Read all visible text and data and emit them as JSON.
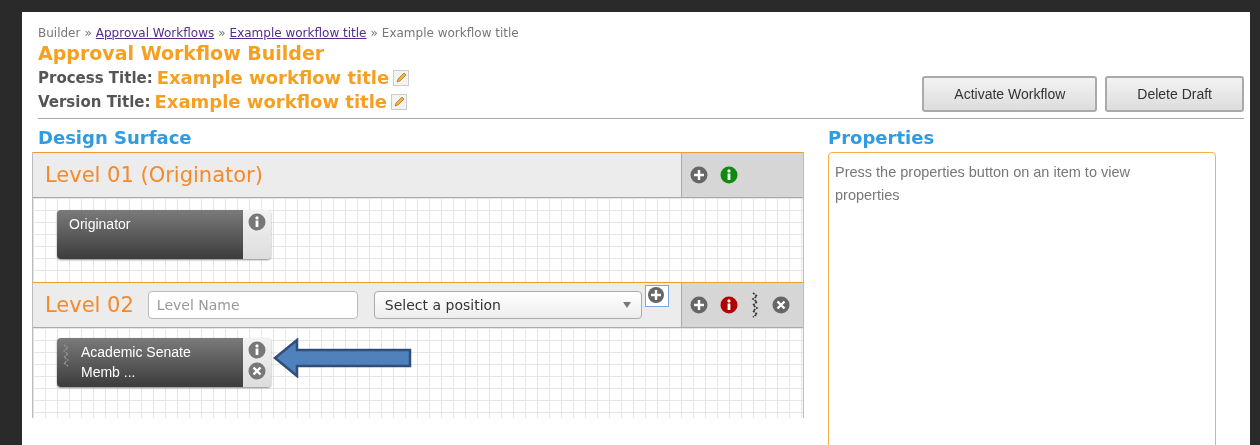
{
  "breadcrumb": [
    {
      "label": "Builder",
      "link": false
    },
    {
      "label": "Approval Workflows",
      "link": true
    },
    {
      "label": "Example workflow title",
      "link": true
    },
    {
      "label": "Example workflow title",
      "link": false
    }
  ],
  "breadcrumb_separator": "»",
  "page_title": "Approval Workflow Builder",
  "titles": [
    {
      "label": "Process Title:",
      "value": "Example workflow title"
    },
    {
      "label": "Version Title:",
      "value": "Example workflow title"
    }
  ],
  "buttons": [
    "Activate Workflow",
    "Delete Draft"
  ],
  "design_surface": {
    "heading": "Design Surface",
    "levels": [
      {
        "kind": "fixed",
        "title": "Level 01 (Originator)",
        "color": "#0f8a0f",
        "nodes": [
          {
            "kind": "fixed",
            "label": "Originator"
          }
        ]
      },
      {
        "kind": "editable",
        "title": "Level 02",
        "name_field": {
          "placeholder": "Level Name"
        },
        "position_select": {
          "value": "Select a position"
        },
        "color": "#b40000",
        "nodes": [
          {
            "kind": "removable",
            "label": "Academic Senate Memb ...",
            "pointer": true
          }
        ]
      }
    ]
  },
  "properties": {
    "heading": "Properties",
    "message": "Press the properties button on an item to view properties"
  }
}
